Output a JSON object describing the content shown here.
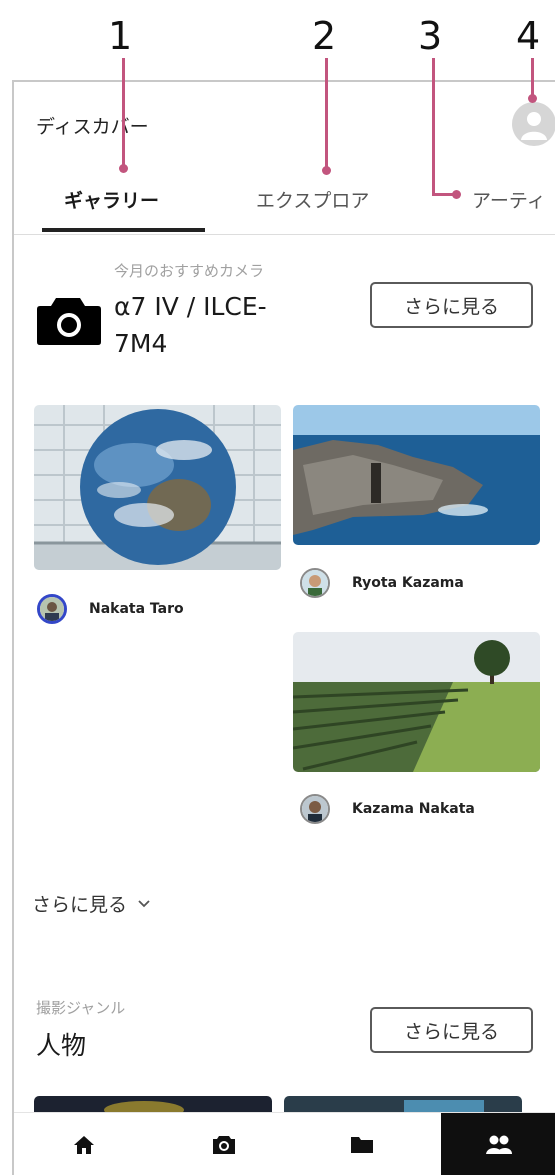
{
  "callouts": [
    "1",
    "2",
    "3",
    "4"
  ],
  "header": {
    "title": "ディスカバー"
  },
  "tabs": [
    {
      "label": "ギャラリー",
      "active": true
    },
    {
      "label": "エクスプロア",
      "active": false
    },
    {
      "label": "アーティ",
      "active": false
    }
  ],
  "camera_section": {
    "subtitle": "今月のおすすめカメラ",
    "title_line1": "α7 IV / ILCE-",
    "title_line2": "7M4",
    "more_button": "さらに見る",
    "icon": "camera-icon"
  },
  "gallery": [
    {
      "photo": "earth-globe-photo",
      "user": "Nakata Taro"
    },
    {
      "photo": "sea-cliff-photo",
      "user": "Ryota Kazama"
    },
    {
      "photo": "farm-field-photo",
      "user": "Kazama Nakata"
    }
  ],
  "see_more": {
    "label": "さらに見る",
    "icon": "chevron-down-icon"
  },
  "genre_section": {
    "subtitle": "撮影ジャンル",
    "title": "人物",
    "more_button": "さらに見る"
  },
  "bottom_nav": [
    {
      "icon": "home-icon",
      "active": false
    },
    {
      "icon": "camera-icon",
      "active": false
    },
    {
      "icon": "folder-icon",
      "active": false
    },
    {
      "icon": "people-icon",
      "active": true
    }
  ],
  "colors": {
    "callout": "#c2557e",
    "active_nav": "#0f0f0f",
    "accent_text": "#1a1a1a"
  }
}
